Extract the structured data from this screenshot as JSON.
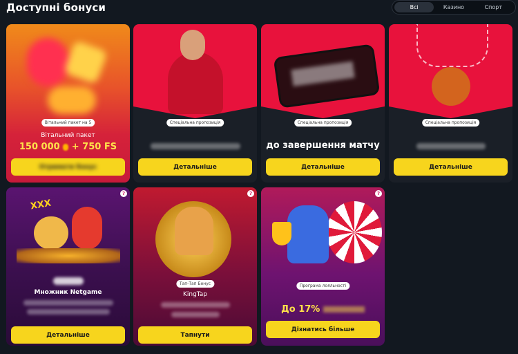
{
  "header": {
    "title": "Доступні бонуси",
    "tabs": [
      "Всі",
      "Казино",
      "Спорт"
    ],
    "active_tab": "Всі"
  },
  "cards": [
    {
      "badge": "Вітальний пакет на 5",
      "title": "Вітальний пакет",
      "amount": "150 000",
      "extra": "+ 750 FS",
      "button": "Отримати бонус"
    },
    {
      "badge": "Спеціальна пропозиція",
      "button": "Детальніше"
    },
    {
      "badge": "Спеціальна пропозиція",
      "headline": "до завершення матчу",
      "button": "Детальніше"
    },
    {
      "badge": "Спеціальна пропозиція",
      "button": "Детальніше"
    },
    {
      "title": "Множник Netgame",
      "logo_text": "XXX",
      "button": "Детальніше"
    },
    {
      "badge": "Тап-Тап Бонус",
      "title": "KingTap",
      "button": "Тапнути"
    },
    {
      "badge": "Програма лояльності",
      "headline": "До 17%",
      "button": "Дізнатись більше"
    }
  ],
  "colors": {
    "accent_yellow": "#f7d51d",
    "background": "#121820",
    "sport_red": "#e8123c",
    "casino_purple": "#5b0f4a"
  }
}
